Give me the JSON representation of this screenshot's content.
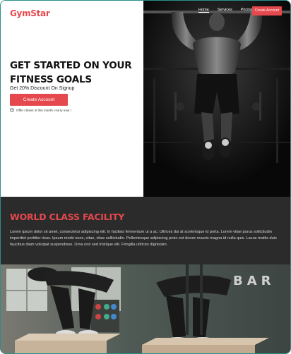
{
  "header": {
    "logo": "GymStar",
    "nav": [
      {
        "label": "Home",
        "active": true
      },
      {
        "label": "Services",
        "active": false
      },
      {
        "label": "Pricing",
        "active": false
      }
    ],
    "nav_cta": "Create Account"
  },
  "hero": {
    "title": "GET STARTED ON YOUR FITNESS GOALS",
    "subtitle": "Get 20% Discount On Signup",
    "cta": "Create Account",
    "offer": "Offer closes in this month. Hurry now !"
  },
  "facility": {
    "title": "WORLD CLASS FACILITY",
    "text": "Lorem ipsum dolor sit amet, consectetur adipiscing elit. In facilisis fermentum ut a ac. Ultrices dui at scelerisque id porta. Lorem vitae purus sollicitudin imperdiet porttitor risus. Ipsum morbi nunc, vitae, vitae sollicitudin. Pellentesque adipiscing proin est donec mauris magna id nulla quis. Lacus mattis duis faucibus diam volutpat suspendisse. Urna non sed tristique elit. Fringilla ultrices dignissim."
  },
  "photo": {
    "wall_text": "BAR"
  },
  "colors": {
    "accent": "#e5484d",
    "dark_section": "#2b2b2b",
    "frame_border": "#2a8f8a"
  }
}
